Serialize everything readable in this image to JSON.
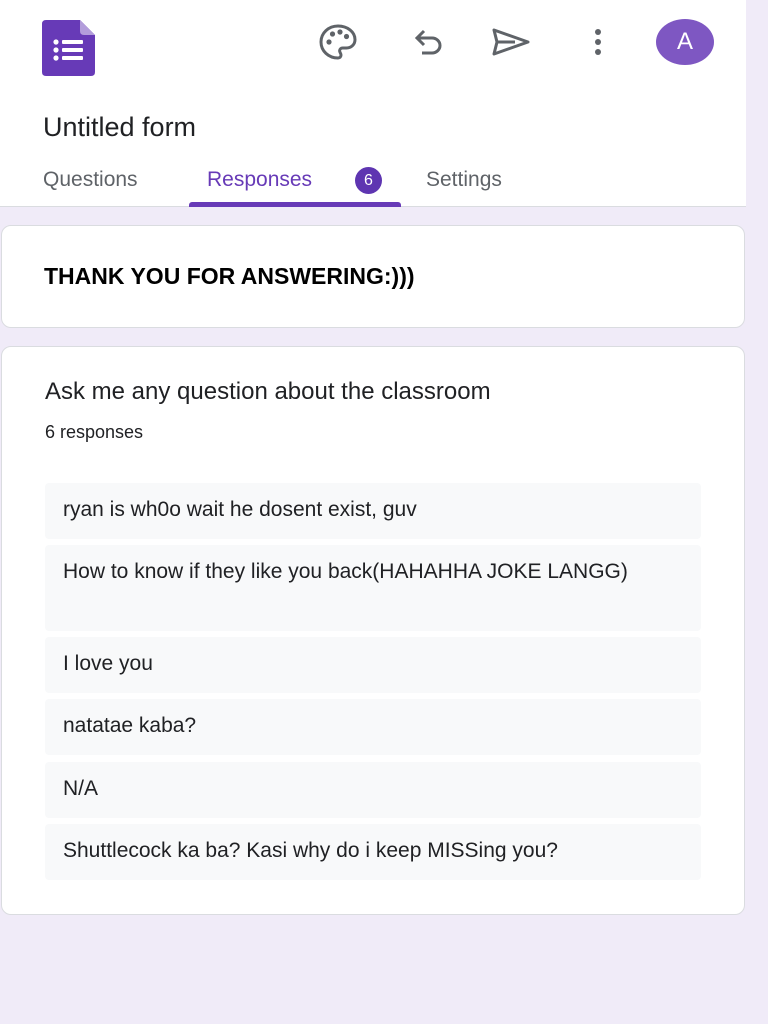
{
  "header": {
    "title": "Untitled form",
    "avatar_initial": "A",
    "icons": [
      "forms-logo-icon",
      "palette-icon",
      "undo-icon",
      "send-icon",
      "more-vert-icon"
    ]
  },
  "tabs": [
    {
      "label": "Questions",
      "active": false
    },
    {
      "label": "Responses",
      "active": true,
      "badge": "6"
    },
    {
      "label": "Settings",
      "active": false
    }
  ],
  "section_header": {
    "text": "THANK YOU FOR ANSWERING:)))"
  },
  "question": {
    "title": "Ask me any question about the classroom",
    "response_count": "6 responses",
    "responses": [
      "ryan is wh0o wait he dosent exist, guv",
      "How to know if they like you back(HAHAHHA JOKE LANGG)",
      "I love you",
      "natatae kaba?",
      "N/A",
      "Shuttlecock ka ba? Kasi why do i keep MISSing you?"
    ]
  },
  "colors": {
    "accent": "#673ab7",
    "background": "#f0ebf8",
    "avatar": "#7e57c2",
    "response_bg": "#f8f9fa"
  }
}
